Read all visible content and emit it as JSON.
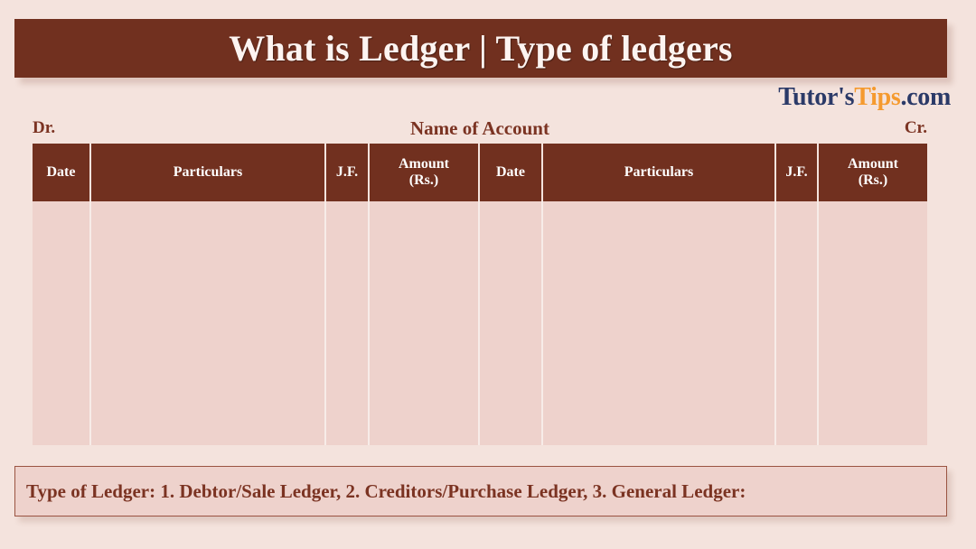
{
  "title": {
    "text": "What is Ledger | Type of ledgers"
  },
  "brand": {
    "part1": "Tutor's",
    "part2": "Tips",
    "part3": ".com"
  },
  "account_row": {
    "debit_label": "Dr.",
    "account_name": "Name of Account",
    "credit_label": "Cr."
  },
  "table": {
    "columns": [
      {
        "label": "Date"
      },
      {
        "label": "Particulars"
      },
      {
        "label": "J.F."
      },
      {
        "label": "Amount",
        "label_line2": "(Rs.)"
      },
      {
        "label": "Date"
      },
      {
        "label": "Particulars"
      },
      {
        "label": "J.F."
      },
      {
        "label": "Amount",
        "label_line2": "(Rs.)"
      }
    ],
    "rows": [
      [
        "",
        "",
        "",
        "",
        "",
        "",
        "",
        ""
      ]
    ]
  },
  "caption": {
    "text": "Type of Ledger: 1. Debtor/Sale Ledger, 2. Creditors/Purchase Ledger, 3. General Ledger:"
  },
  "colors": {
    "page_background": "#f4e3dd",
    "header_brown": "#71301f",
    "table_fill": "#eed2cc",
    "accent_text": "#7b3322",
    "brand_dark": "#2b3a68",
    "brand_accent": "#f59a2e"
  }
}
